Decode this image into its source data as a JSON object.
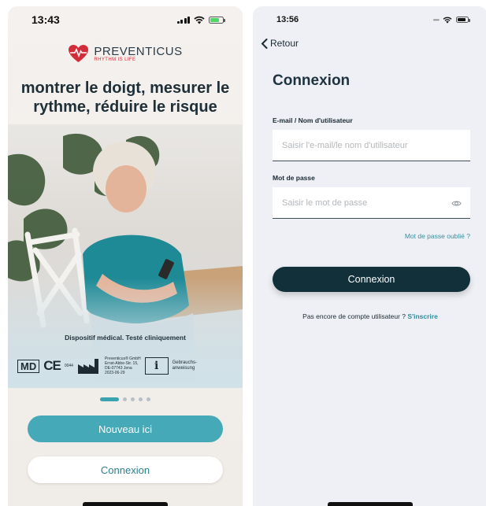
{
  "left": {
    "status_time": "13:43",
    "brand": "PREVENTICUS",
    "brand_tagline": "RHYTHM IS LIFE",
    "headline": "montrer le doigt, mesurer le rythme, réduire le risque",
    "caption": "Dispositif médical. Testé cliniquement",
    "certs": {
      "md": "MD",
      "ce": "CE",
      "ce_number": "0044",
      "manufacturer_lines": [
        "Preventicus® GmbH",
        "Ernst-Abbe-Str. 15,",
        "DE-07743 Jena",
        "2023-06-29"
      ],
      "ifu_symbol": "i",
      "ifu_lines": [
        "Gebrauchs-",
        "anweisung"
      ]
    },
    "carousel": {
      "count": 5,
      "active": 0
    },
    "primary_button": "Nouveau ici",
    "secondary_button": "Connexion",
    "colors": {
      "primary": "#46a9b7",
      "heart": "#d32c3a"
    },
    "battery_fill": 0.7
  },
  "right": {
    "status_time": "13:56",
    "back_label": "Retour",
    "title": "Connexion",
    "email_label": "E-mail / Nom d'utilisateur",
    "email_placeholder": "Saisir l'e-mail/le nom d'utilisateur",
    "password_label": "Mot de passe",
    "password_placeholder": "Saisir le mot de passe",
    "forgot_link": "Mot de passe oublié ?",
    "login_button": "Connexion",
    "signup_text": "Pas encore de compte utilisateur ?",
    "signup_link": "S'inscrire",
    "colors": {
      "button": "#12303a",
      "link": "#2f8a98"
    },
    "battery_fill": 0.8
  }
}
